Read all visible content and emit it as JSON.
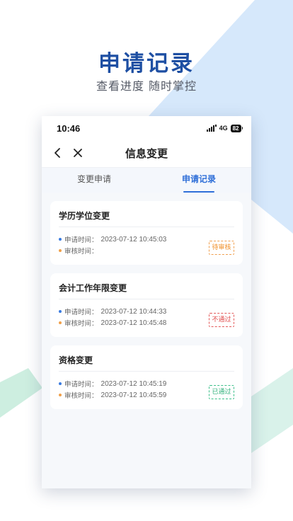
{
  "promo": {
    "title": "申请记录",
    "subtitle": "查看进度  随时掌控"
  },
  "colors": {
    "accent": "#2f6fd8",
    "title": "#1e4fa3",
    "pending": "#f0902a",
    "reject": "#e04848",
    "pass": "#2fb07a"
  },
  "status_bar": {
    "time": "10:46",
    "network": "4G",
    "battery": "82"
  },
  "nav": {
    "title": "信息变更",
    "back_icon": "chevron-left-icon",
    "close_icon": "close-icon"
  },
  "tabs": [
    {
      "label": "变更申请",
      "active": false
    },
    {
      "label": "申请记录",
      "active": true
    }
  ],
  "records": [
    {
      "title": "学历学位变更",
      "apply_label": "申请时间：",
      "apply_time": "2023-07-12 10:45:03",
      "review_label": "审核时间：",
      "review_time": "",
      "status": "待审核"
    },
    {
      "title": "会计工作年限变更",
      "apply_label": "申请时间：",
      "apply_time": "2023-07-12 10:44:33",
      "review_label": "审核时间：",
      "review_time": "2023-07-12 10:45:48",
      "status": "不通过"
    },
    {
      "title": "资格变更",
      "apply_label": "申请时间：",
      "apply_time": "2023-07-12 10:45:19",
      "review_label": "审核时间：",
      "review_time": "2023-07-12 10:45:59",
      "status": "已通过"
    }
  ]
}
